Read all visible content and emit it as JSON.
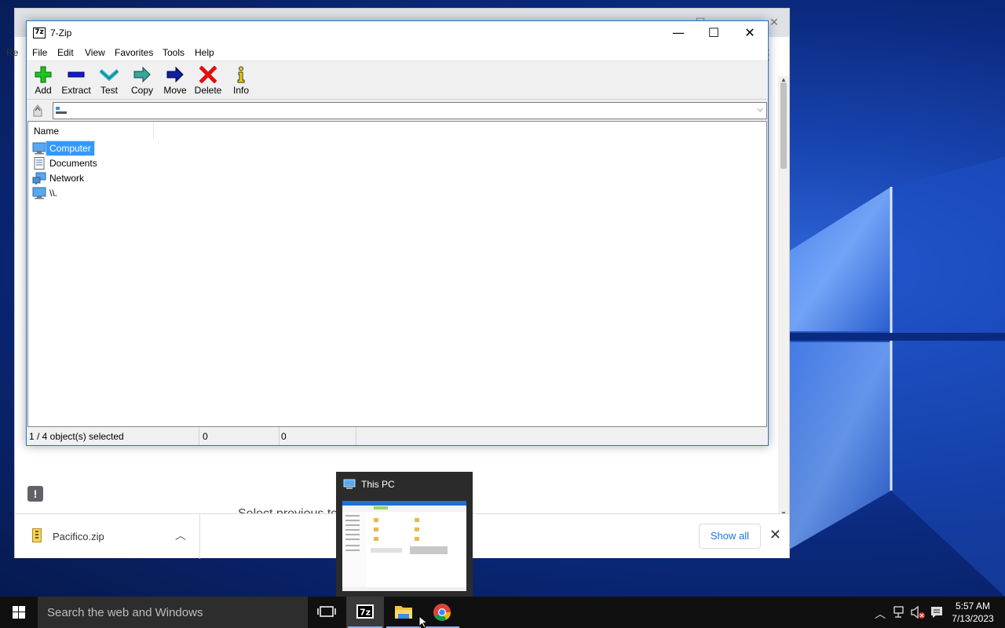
{
  "zip_window": {
    "title": "7-Zip",
    "app_icon_text": "7z",
    "controls": {
      "minimize": "—",
      "maximize": "☐",
      "close": "✕"
    },
    "menu": [
      "File",
      "Edit",
      "View",
      "Favorites",
      "Tools",
      "Help"
    ],
    "toolbar": [
      {
        "label": "Add",
        "icon": "add-icon"
      },
      {
        "label": "Extract",
        "icon": "extract-icon"
      },
      {
        "label": "Test",
        "icon": "test-icon"
      },
      {
        "label": "Copy",
        "icon": "copy-icon"
      },
      {
        "label": "Move",
        "icon": "move-icon"
      },
      {
        "label": "Delete",
        "icon": "delete-icon"
      },
      {
        "label": "Info",
        "icon": "info-icon"
      }
    ],
    "address": {
      "value": ""
    },
    "list": {
      "column_name": "Name",
      "rows": [
        {
          "label": "Computer",
          "icon": "computer-icon",
          "selected": true
        },
        {
          "label": "Documents",
          "icon": "documents-icon",
          "selected": false
        },
        {
          "label": "Network",
          "icon": "network-icon",
          "selected": false
        },
        {
          "label": "\\\\.",
          "icon": "drive-icon",
          "selected": false
        }
      ]
    },
    "status": {
      "selection": "1 / 4 object(s) selected",
      "size": "0",
      "packed": "0"
    }
  },
  "chrome_window": {
    "edge_text": "Re",
    "partial_text": "Select previous to",
    "download": {
      "filename": "Pacifico.zip"
    },
    "show_all_label": "Show all"
  },
  "thumbnail": {
    "title": "This PC"
  },
  "taskbar": {
    "search_placeholder": "Search the web and Windows",
    "time": "5:57 AM",
    "date": "7/13/2023"
  }
}
